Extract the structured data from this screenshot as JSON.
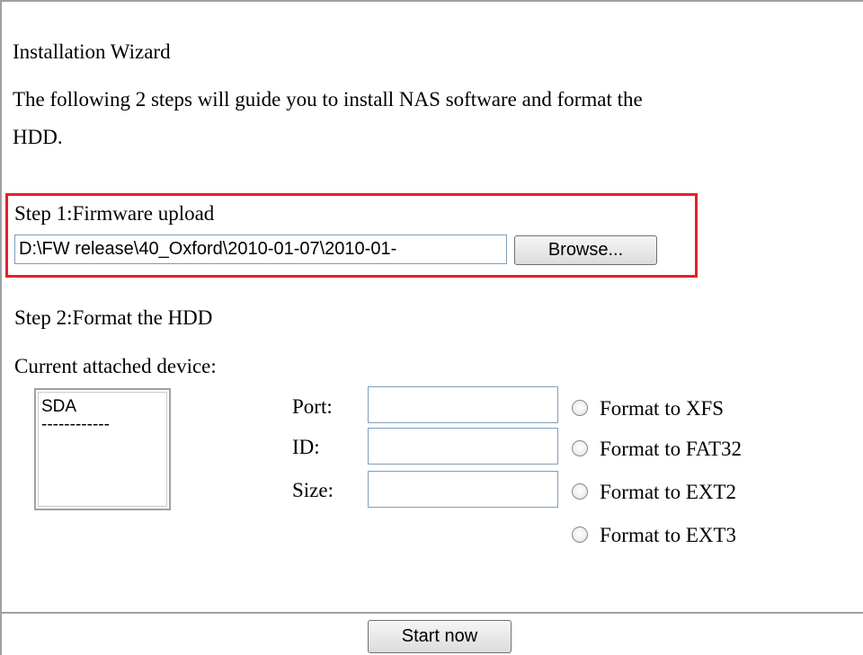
{
  "wizard": {
    "title": "Installation Wizard",
    "intro_line1": "The following 2 steps will guide you to install NAS software and format the",
    "intro_line2": "HDD."
  },
  "step1": {
    "label": "Step 1:Firmware upload",
    "file_path": "D:\\FW release\\40_Oxford\\2010-01-07\\2010-01-",
    "browse_label": "Browse...",
    "highlight_color": "#e0222e"
  },
  "step2": {
    "label": "Step 2:Format the HDD",
    "device_label": "Current attached device:",
    "device_list": [
      "SDA",
      "------------"
    ],
    "fields": [
      {
        "label": "Port:",
        "value": ""
      },
      {
        "label": "ID:",
        "value": ""
      },
      {
        "label": "Size:",
        "value": ""
      }
    ],
    "format_options": [
      "Format to XFS",
      "Format to FAT32",
      "Format to EXT2",
      "Format to EXT3"
    ]
  },
  "footer": {
    "start_label": "Start now"
  }
}
